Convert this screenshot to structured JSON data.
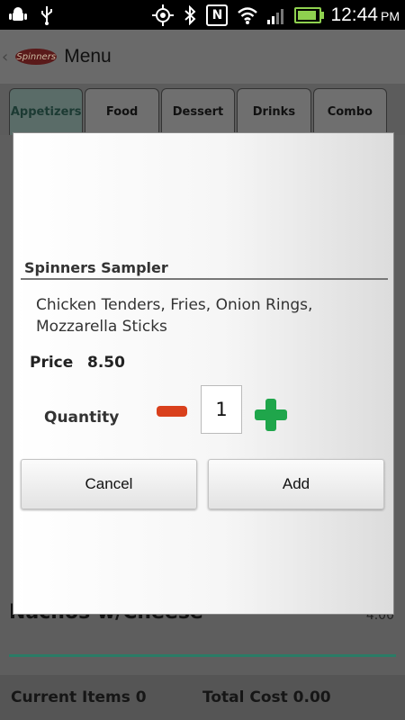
{
  "status_bar": {
    "time": "12:44",
    "ampm": "PM",
    "icons": [
      "android-icon",
      "usb-icon",
      "gps-icon",
      "bluetooth-icon",
      "nfc-icon",
      "wifi-icon",
      "signal-icon",
      "battery-icon"
    ]
  },
  "action_bar": {
    "title": "Menu",
    "logo_text": "Spinners"
  },
  "tabs": [
    {
      "label": "Appetizers",
      "active": true
    },
    {
      "label": "Food",
      "active": false
    },
    {
      "label": "Dessert",
      "active": false
    },
    {
      "label": "Drinks",
      "active": false
    },
    {
      "label": "Combo",
      "active": false
    }
  ],
  "background_list": {
    "visible_item": "Nachos w/Cheese",
    "visible_price": "4.00"
  },
  "footer": {
    "current_items": "Current Items 0",
    "total_cost": "Total Cost 0.00"
  },
  "dialog": {
    "title": "Spinners Sampler",
    "description": "Chicken Tenders, Fries, Onion Rings, Mozzarella Sticks",
    "price_label": "Price",
    "price_value": "8.50",
    "quantity_label": "Quantity",
    "quantity_value": "1",
    "cancel_label": "Cancel",
    "add_label": "Add"
  },
  "colors": {
    "minus": "#d9401c",
    "plus": "#1fa64b",
    "battery": "#8fd14f",
    "accent_line": "#2a7c66"
  }
}
